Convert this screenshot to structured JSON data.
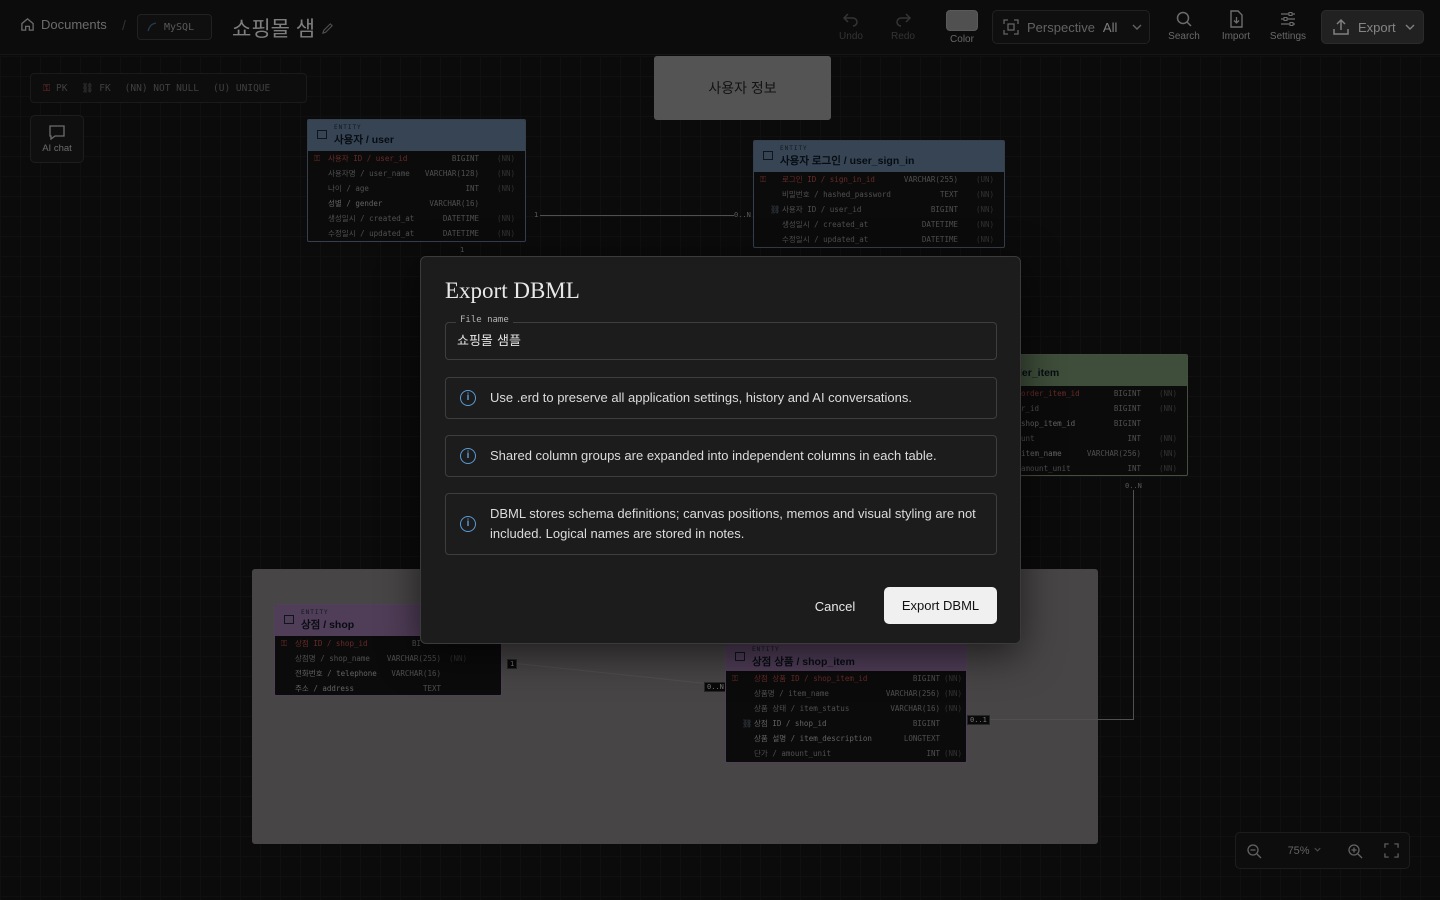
{
  "topbar": {
    "breadcrumb_home": "Documents",
    "db_badge": "MySQL",
    "doc_title": "쇼핑몰 샘",
    "tools": {
      "undo": "Undo",
      "redo": "Redo",
      "color": "Color",
      "perspective_label": "Perspective",
      "perspective_value": "All",
      "search": "Search",
      "import": "Import",
      "settings": "Settings",
      "export": "Export"
    }
  },
  "legend": {
    "pk": "PK",
    "fk": "FK",
    "nn": "(NN) NOT NULL",
    "u": "(U) UNIQUE"
  },
  "ai_chat": "AI chat",
  "memo": "사용자 정보",
  "entities": {
    "user": {
      "tag": "ENTITY",
      "name": "사용자 / user",
      "rows": [
        {
          "name": "사용자 ID / user_id",
          "type": "BIGINT",
          "nn": "(NN)"
        },
        {
          "name": "사용자명 / user_name",
          "type": "VARCHAR(128)",
          "nn": "(NN)"
        },
        {
          "name": "나이 / age",
          "type": "INT",
          "nn": "(NN)"
        },
        {
          "name": "성별 / gender",
          "type": "VARCHAR(16)",
          "nn": ""
        },
        {
          "name": "생성일시 / created_at",
          "type": "DATETIME",
          "nn": "(NN)"
        },
        {
          "name": "수정일시 / updated_at",
          "type": "DATETIME",
          "nn": "(NN)"
        }
      ]
    },
    "sign_in": {
      "tag": "ENTITY",
      "name": "사용자 로그인 / user_sign_in",
      "rows": [
        {
          "name": "로그인 ID / sign_in_id",
          "type": "VARCHAR(255)",
          "nn": "(UN)"
        },
        {
          "name": "비밀번호 / hashed_password",
          "type": "TEXT",
          "nn": "(NN)"
        },
        {
          "name": "사용자 ID / user_id",
          "type": "BIGINT",
          "nn": "(NN)"
        },
        {
          "name": "생성일시 / created_at",
          "type": "DATETIME",
          "nn": "(NN)"
        },
        {
          "name": "수정일시 / updated_at",
          "type": "DATETIME",
          "nn": "(NN)"
        }
      ]
    },
    "order_item": {
      "name": "ler_item",
      "rows": [
        {
          "name": "order_item_id",
          "type": "BIGINT",
          "nn": "(NN)"
        },
        {
          "name": "r_id",
          "type": "BIGINT",
          "nn": "(NN)"
        },
        {
          "name": "shop_item_id",
          "type": "BIGINT",
          "nn": ""
        },
        {
          "name": "unt",
          "type": "INT",
          "nn": "(NN)"
        },
        {
          "name": "item_name",
          "type": "VARCHAR(256)",
          "nn": "(NN)"
        },
        {
          "name": "amount_unit",
          "type": "INT",
          "nn": "(NN)"
        }
      ]
    },
    "shop": {
      "tag": "ENTITY",
      "name": "상점 / shop",
      "rows": [
        {
          "name": "상점 ID / shop_id",
          "type": "BI",
          "nn": ""
        },
        {
          "name": "상점명 / shop_name",
          "type": "VARCHAR(255)",
          "nn": "(NN)"
        },
        {
          "name": "전화번호 / telephone",
          "type": "VARCHAR(16)",
          "nn": ""
        },
        {
          "name": "주소 / address",
          "type": "TEXT",
          "nn": ""
        }
      ]
    },
    "shop_item": {
      "tag": "ENTITY",
      "name": "상점 상품 / shop_item",
      "rows": [
        {
          "name": "상점 상품 ID / shop_item_id",
          "type": "BIGINT",
          "nn": "(NN)"
        },
        {
          "name": "상품명 / item_name",
          "type": "VARCHAR(256)",
          "nn": "(NN)"
        },
        {
          "name": "상품 상태 / item_status",
          "type": "VARCHAR(16)",
          "nn": "(NN)"
        },
        {
          "name": "상점 ID / shop_id",
          "type": "BIGINT",
          "nn": ""
        },
        {
          "name": "상품 설명 / item_description",
          "type": "LONGTEXT",
          "nn": ""
        },
        {
          "name": "단가 / amount_unit",
          "type": "INT",
          "nn": "(NN)"
        }
      ]
    }
  },
  "cardinality": {
    "one": "1",
    "many": "0..N",
    "one_b": "1",
    "many_b": "0..N",
    "many_c": "0..N",
    "one_c": "0..1"
  },
  "zoom": {
    "level": "75%"
  },
  "dialog": {
    "title": "Export DBML",
    "file_label": "File name",
    "file_value": "쇼핑몰 샘플",
    "info1": "Use .erd to preserve all application settings, history and AI conversations.",
    "info2": "Shared column groups are expanded into independent columns in each table.",
    "info3": "DBML stores schema definitions; canvas positions, memos and visual styling are not included. Logical names are stored in notes.",
    "cancel": "Cancel",
    "export": "Export DBML"
  }
}
